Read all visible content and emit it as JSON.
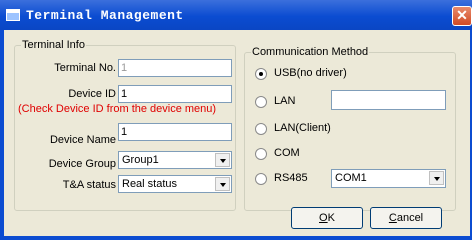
{
  "window": {
    "title": "Terminal Management"
  },
  "terminal_info": {
    "legend": "Terminal Info",
    "terminal_no": {
      "label": "Terminal No.",
      "value": "1"
    },
    "device_id": {
      "label": "Device ID",
      "value": "1"
    },
    "hint": "(Check Device ID from the device menu)",
    "device_name": {
      "label": "Device Name",
      "value": "1"
    },
    "device_group": {
      "label": "Device Group",
      "value": "Group1"
    },
    "ta_status": {
      "label": "T&A status",
      "value": "Real status"
    }
  },
  "communication": {
    "legend": "Communication Method",
    "options": [
      {
        "label": "USB(no driver)",
        "checked": true
      },
      {
        "label": "LAN",
        "checked": false
      },
      {
        "label": "LAN(Client)",
        "checked": false
      },
      {
        "label": "COM",
        "checked": false
      },
      {
        "label": "RS485",
        "checked": false
      }
    ],
    "lan_value": "",
    "rs485_port": "COM1"
  },
  "buttons": {
    "ok": {
      "mnemonic": "O",
      "rest": "K"
    },
    "cancel": {
      "mnemonic": "C",
      "rest": "ancel"
    }
  }
}
